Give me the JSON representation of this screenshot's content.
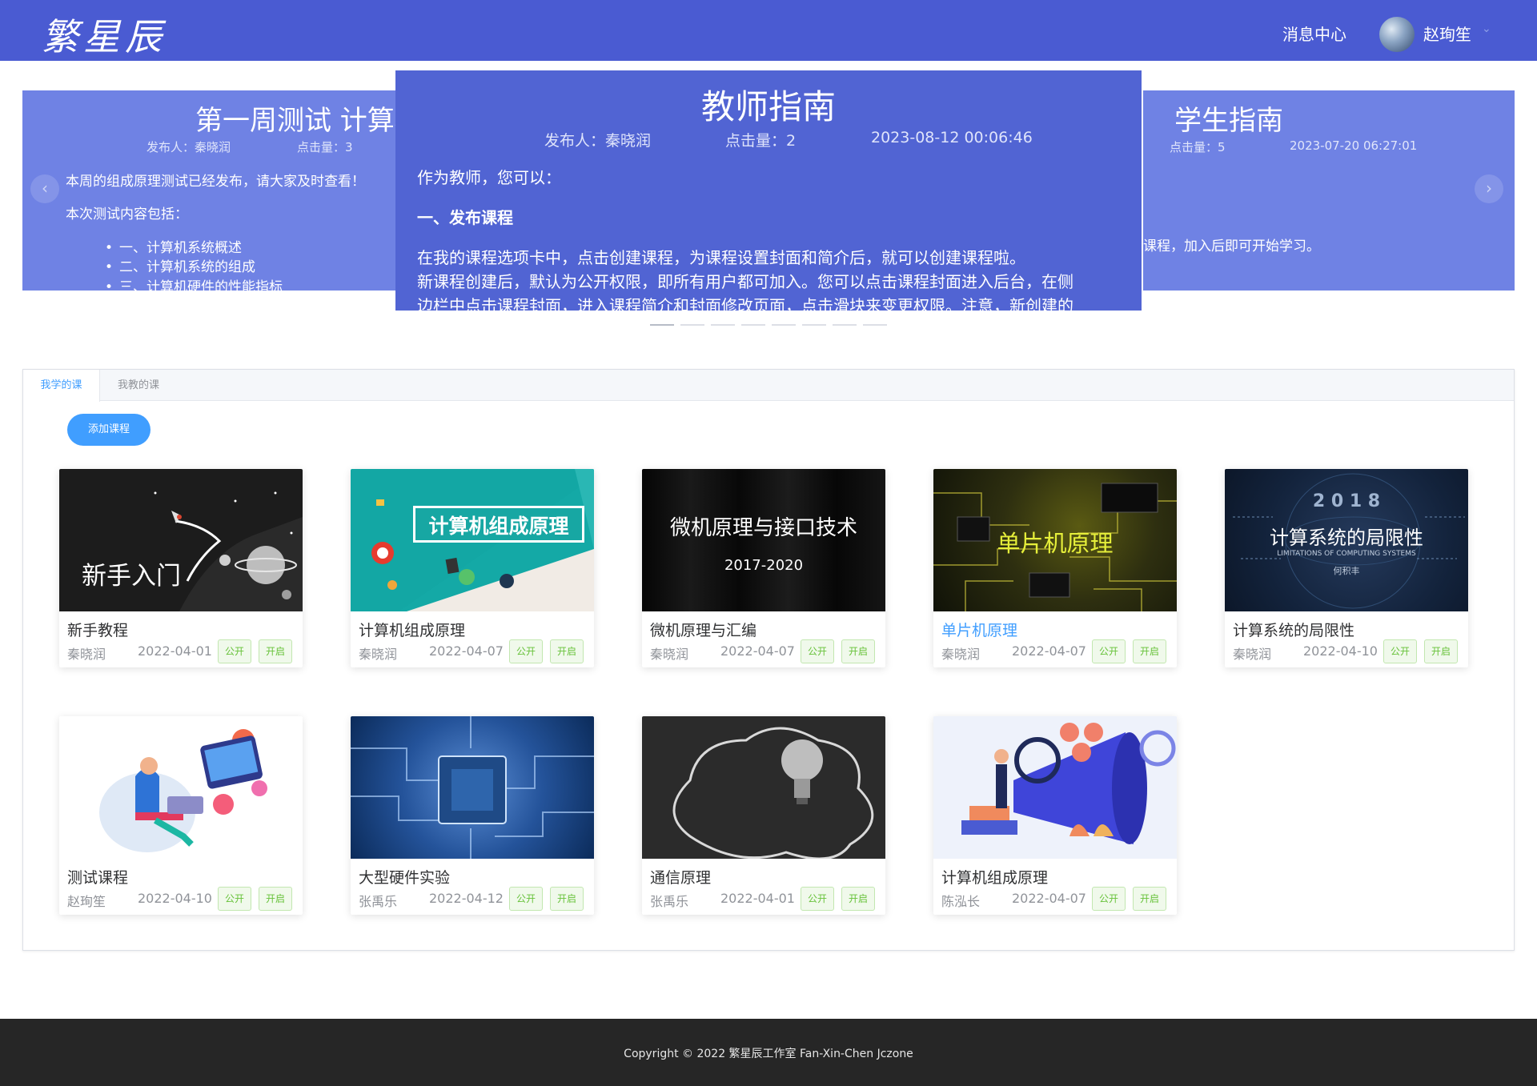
{
  "header": {
    "logo_text": "繁星辰",
    "message_center": "消息中心",
    "username": "赵珣笙"
  },
  "carousel": {
    "left_slide": {
      "title": "第一周测试 计算机",
      "publisher": "发布人：秦晓润",
      "clicks": "点击量：3",
      "body": [
        "本周的组成原理测试已经发布，请大家及时查看！",
        "本次测试内容包括："
      ],
      "list": [
        "一、计算机系统概述",
        "二、计算机系统的组成",
        "三、计算机硬件的性能指标"
      ]
    },
    "active_slide": {
      "title": "教师指南",
      "publisher": "发布人：秦晓润",
      "clicks": "点击量：2",
      "date": "2023-08-12 00:06:46",
      "lines": [
        "作为教师，您可以：",
        "一、发布课程",
        "在我的课程选项卡中，点击创建课程，为课程设置封面和简介后，就可以创建课程啦。",
        "新课程创建后，默认为公开权限，即所有用户都可加入。您可以点击课程封面进入后台，在侧",
        "边栏中点击课程封面，进入课程简介和封面修改页面，点击滑块来变更权限。注意，新创建的"
      ]
    },
    "right_slide": {
      "title": "学生指南",
      "clicks": "点击量：5",
      "date": "2023-07-20 06:27:01",
      "body": "课程，加入后即可开始学习。"
    },
    "prev_icon": "‹",
    "next_icon": "›"
  },
  "tabs": [
    {
      "label": "我学的课",
      "active": true
    },
    {
      "label": "我教的课",
      "active": false
    }
  ],
  "add_course_label": "添加课程",
  "courses": [
    {
      "title": "新手教程",
      "author": "秦晓润",
      "date": "2022-04-01",
      "cover_text": "新手入门",
      "public": "公开",
      "status": "开启"
    },
    {
      "title": "计算机组成原理",
      "author": "秦晓润",
      "date": "2022-04-07",
      "cover_text": "计算机组成原理",
      "public": "公开",
      "status": "开启"
    },
    {
      "title": "微机原理与汇编",
      "author": "秦晓润",
      "date": "2022-04-07",
      "cover_text": "微机原理与接口技术",
      "cover_sub": "2017-2020",
      "public": "公开",
      "status": "开启"
    },
    {
      "title": "单片机原理",
      "author": "秦晓润",
      "date": "2022-04-07",
      "cover_text": "单片机原理",
      "public": "公开",
      "status": "开启"
    },
    {
      "title": "计算系统的局限性",
      "author": "秦晓润",
      "date": "2022-04-10",
      "cover_year": "2 0 1 8",
      "cover_text": "计算系统的局限性",
      "cover_sub": "LIMITATIONS OF COMPUTING SYSTEMS",
      "cover_author": "何积丰",
      "public": "公开",
      "status": "开启"
    },
    {
      "title": "测试课程",
      "author": "赵珣笙",
      "date": "2022-04-10",
      "public": "公开",
      "status": "开启"
    },
    {
      "title": "大型硬件实验",
      "author": "张禹乐",
      "date": "2022-04-12",
      "public": "公开",
      "status": "开启"
    },
    {
      "title": "通信原理",
      "author": "张禹乐",
      "date": "2022-04-01",
      "public": "公开",
      "status": "开启"
    },
    {
      "title": "计算机组成原理",
      "author": "陈泓长",
      "date": "2022-04-07",
      "public": "公开",
      "status": "开启"
    }
  ],
  "footer": {
    "copyright": "Copyright © 2022 繁星辰工作室 Fan-Xin-Chen Jczone"
  },
  "colors": {
    "header_bg": "#4a5bd2",
    "slide_bg": "#6f82e4",
    "active_slide_bg": "#5164d3",
    "primary": "#409eff",
    "tag_green": "#67c23a",
    "footer_bg": "#262626"
  }
}
